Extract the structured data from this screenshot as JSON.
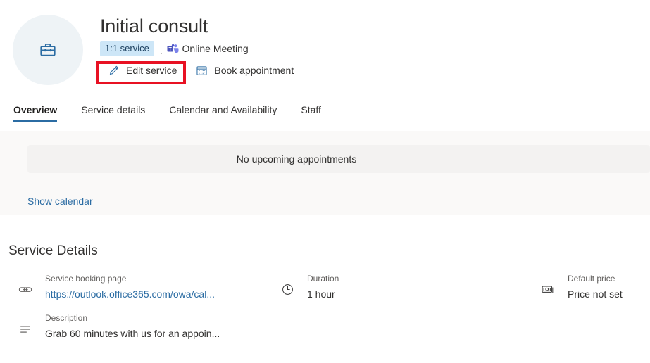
{
  "header": {
    "avatar_icon": "briefcase-icon",
    "title": "Initial consult",
    "badge": "1:1 service",
    "separator": ".",
    "meeting_icon": "teams-icon",
    "meeting_label": "Online Meeting",
    "actions": {
      "edit": {
        "icon": "pencil-icon",
        "label": "Edit service"
      },
      "book": {
        "icon": "calendar-icon",
        "label": "Book appointment"
      }
    },
    "highlight_color": "#e81123"
  },
  "tabs": [
    {
      "label": "Overview",
      "active": true
    },
    {
      "label": "Service details",
      "active": false
    },
    {
      "label": "Calendar and Availability",
      "active": false
    },
    {
      "label": "Staff",
      "active": false
    }
  ],
  "appointments": {
    "empty_message": "No upcoming appointments",
    "show_calendar_label": "Show calendar"
  },
  "service_details": {
    "section_title": "Service Details",
    "items": [
      {
        "icon": "link-icon",
        "label": "Service booking page",
        "value": "https://outlook.office365.com/owa/cal...",
        "is_link": true
      },
      {
        "icon": "description-icon",
        "label": "Description",
        "value": "Grab 60 minutes with us for an appoin...",
        "is_link": false
      },
      {
        "icon": "clock-icon",
        "label": "Duration",
        "value": "1 hour",
        "is_link": false
      },
      {
        "icon": "money-icon",
        "label": "Default price",
        "value": "Price not set",
        "is_link": false
      }
    ]
  },
  "colors": {
    "accent_blue": "#2b6ca3",
    "badge_bg": "#cde6f7",
    "panel_bg": "#faf9f8",
    "inner_bg": "#f3f2f1",
    "text": "#323130",
    "muted_text": "#605e5c",
    "highlight_red": "#e81123"
  }
}
